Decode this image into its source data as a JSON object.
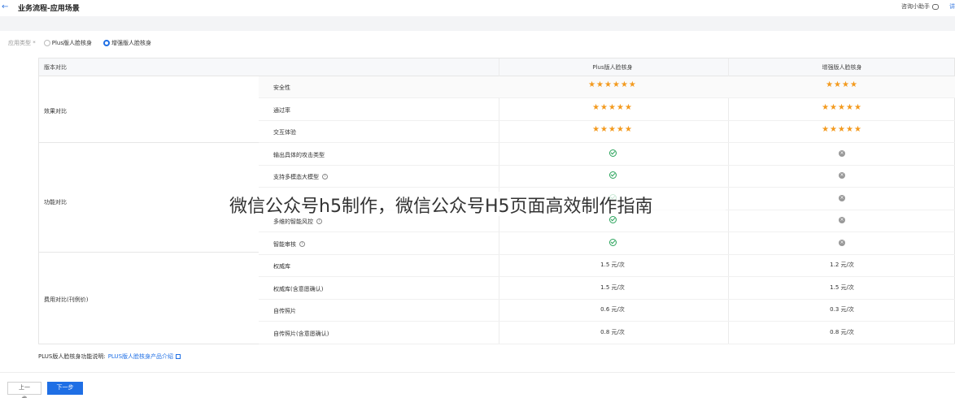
{
  "header": {
    "back_icon": "←",
    "title": "业务流程-应用场景",
    "assistant_label": "咨询小助手",
    "edge_text": "讲"
  },
  "scene": {
    "label": "应用类型 *",
    "options": [
      {
        "label": "Plus版人脸核身",
        "selected": false
      },
      {
        "label": "增强版人脸核身",
        "selected": true
      }
    ]
  },
  "table": {
    "headers": [
      "版本对比",
      "Plus版人脸核身",
      "增强版人脸核身"
    ],
    "categories": [
      "效果对比",
      "功能对比",
      "费用对比(刊例价)"
    ],
    "rows": [
      {
        "label": "安全性",
        "plus": "★★★★★★",
        "enh": "★★★★",
        "type": "stars"
      },
      {
        "label": "通过率",
        "plus": "★★★★★",
        "enh": "★★★★★",
        "type": "stars"
      },
      {
        "label": "交互体验",
        "plus": "★★★★★",
        "enh": "★★★★★",
        "type": "stars"
      },
      {
        "label": "输出具体的攻击类型",
        "plus": "yes",
        "enh": "no",
        "type": "check"
      },
      {
        "label": "支持多模态大模型",
        "plus": "yes",
        "enh": "no",
        "type": "check",
        "info": true
      },
      {
        "label": "",
        "plus": "yes",
        "enh": "no",
        "type": "check"
      },
      {
        "label": "多维的智能风控",
        "plus": "yes",
        "enh": "no",
        "type": "check",
        "info": true
      },
      {
        "label": "智能审核",
        "plus": "yes",
        "enh": "no",
        "type": "check",
        "info": true
      },
      {
        "label": "权威库",
        "plus": "1.5 元/次",
        "enh": "1.2 元/次",
        "type": "text"
      },
      {
        "label": "权威库(含意愿确认)",
        "plus": "1.5 元/次",
        "enh": "1.5 元/次",
        "type": "text"
      },
      {
        "label": "自传照片",
        "plus": "0.6 元/次",
        "enh": "0.3 元/次",
        "type": "text"
      },
      {
        "label": "自传照片(含意愿确认)",
        "plus": "0.8 元/次",
        "enh": "0.8 元/次",
        "type": "text"
      }
    ]
  },
  "note": {
    "prefix": "PLUS版人脸核身功能说明:",
    "link": "PLUS版人脸核身产品介绍"
  },
  "buttons": {
    "prev": "上一步",
    "next": "下一步"
  },
  "watermark": "微信公众号h5制作，微信公众号H5页面高效制作指南",
  "colors": {
    "accent": "#1f6fe5",
    "star": "#f39a1e",
    "ok": "#29a35a"
  }
}
